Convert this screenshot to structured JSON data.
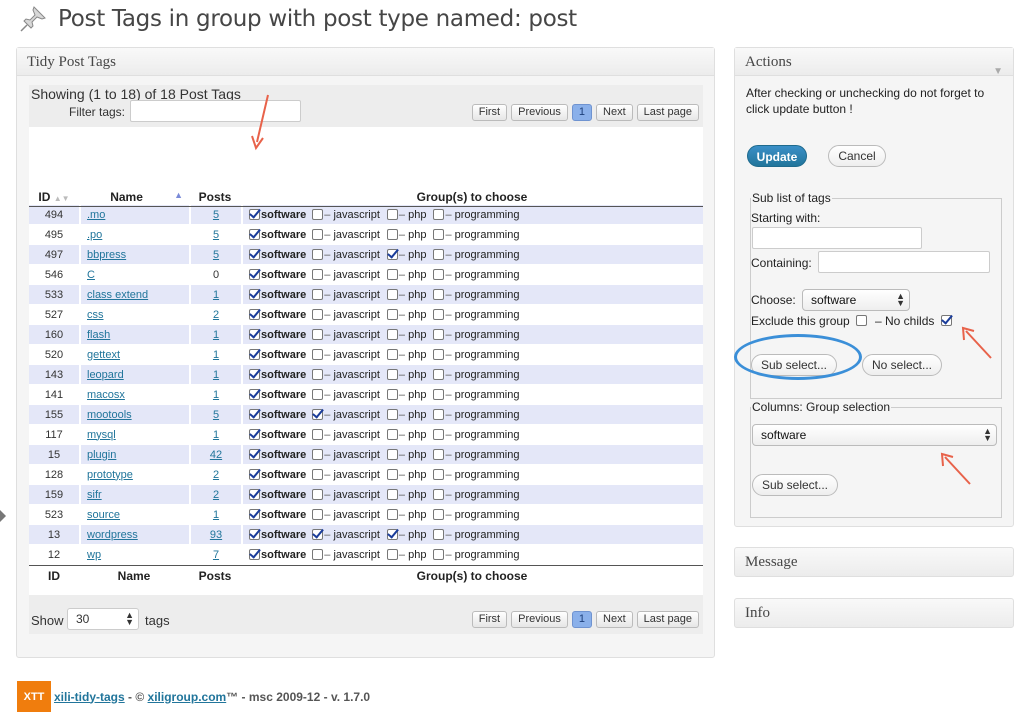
{
  "page": {
    "title": "Post Tags in group with post type named: post"
  },
  "tidy": {
    "title": "Tidy Post Tags",
    "showing": "Showing (1 to 18) of 18 Post Tags",
    "filter_label": "Filter tags:",
    "filter_value": "",
    "pager": {
      "first": "First",
      "previous": "Previous",
      "page": "1",
      "next": "Next",
      "last": "Last page"
    },
    "columns": {
      "id": "ID",
      "name": "Name",
      "posts": "Posts",
      "groups": "Group(s) to choose"
    },
    "group_names": [
      "software",
      "javascript",
      "php",
      "programming"
    ],
    "rows": [
      {
        "id": "494",
        "name": ".mo",
        "posts": "5",
        "posts_link": true,
        "checks": [
          true,
          false,
          false,
          false
        ]
      },
      {
        "id": "495",
        "name": ".po",
        "posts": "5",
        "posts_link": true,
        "checks": [
          true,
          false,
          false,
          false
        ]
      },
      {
        "id": "497",
        "name": "bbpress",
        "posts": "5",
        "posts_link": true,
        "checks": [
          true,
          false,
          true,
          false
        ]
      },
      {
        "id": "546",
        "name": "C",
        "posts": "0",
        "posts_link": false,
        "checks": [
          true,
          false,
          false,
          false
        ]
      },
      {
        "id": "533",
        "name": "class extend",
        "posts": "1",
        "posts_link": true,
        "checks": [
          true,
          false,
          false,
          false
        ]
      },
      {
        "id": "527",
        "name": "css",
        "posts": "2",
        "posts_link": true,
        "checks": [
          true,
          false,
          false,
          false
        ]
      },
      {
        "id": "160",
        "name": "flash",
        "posts": "1",
        "posts_link": true,
        "checks": [
          true,
          false,
          false,
          false
        ]
      },
      {
        "id": "520",
        "name": "gettext",
        "posts": "1",
        "posts_link": true,
        "checks": [
          true,
          false,
          false,
          false
        ]
      },
      {
        "id": "143",
        "name": "leopard",
        "posts": "1",
        "posts_link": true,
        "checks": [
          true,
          false,
          false,
          false
        ]
      },
      {
        "id": "141",
        "name": "macosx",
        "posts": "1",
        "posts_link": true,
        "checks": [
          true,
          false,
          false,
          false
        ]
      },
      {
        "id": "155",
        "name": "mootools",
        "posts": "5",
        "posts_link": true,
        "checks": [
          true,
          true,
          false,
          false
        ]
      },
      {
        "id": "117",
        "name": "mysql",
        "posts": "1",
        "posts_link": true,
        "checks": [
          true,
          false,
          false,
          false
        ]
      },
      {
        "id": "15",
        "name": "plugin",
        "posts": "42",
        "posts_link": true,
        "checks": [
          true,
          false,
          false,
          false
        ]
      },
      {
        "id": "128",
        "name": "prototype",
        "posts": "2",
        "posts_link": true,
        "checks": [
          true,
          false,
          false,
          false
        ]
      },
      {
        "id": "159",
        "name": "sifr",
        "posts": "2",
        "posts_link": true,
        "checks": [
          true,
          false,
          false,
          false
        ]
      },
      {
        "id": "523",
        "name": "source",
        "posts": "1",
        "posts_link": true,
        "checks": [
          true,
          false,
          false,
          false
        ]
      },
      {
        "id": "13",
        "name": "wordpress",
        "posts": "93",
        "posts_link": true,
        "checks": [
          true,
          true,
          true,
          false
        ]
      },
      {
        "id": "12",
        "name": "wp",
        "posts": "7",
        "posts_link": true,
        "checks": [
          true,
          false,
          false,
          false
        ]
      }
    ],
    "show_label": "Show",
    "show_value": "30",
    "tags_label": "tags"
  },
  "actions": {
    "title": "Actions",
    "note": "After checking or unchecking do not forget to click update button !",
    "update_label": "Update",
    "cancel_label": "Cancel",
    "sublist": {
      "legend": "Sub list of tags",
      "starting_label": "Starting with:",
      "containing_label": "Containing:",
      "choose_label": "Choose:",
      "choose_value": "software",
      "exclude_label": "Exclude this group",
      "nochilds_label": "– No childs",
      "exclude_checked": false,
      "nochilds_checked": true,
      "subselect_label": "Sub select...",
      "noselect_label": "No select..."
    },
    "columns": {
      "legend": "Columns: Group selection",
      "value": "software",
      "subselect_label": "Sub select..."
    }
  },
  "message": {
    "title": "Message"
  },
  "info": {
    "title": "Info"
  },
  "footer": {
    "logo": "XTT",
    "plugin": "xili-tidy-tags",
    "sep": " - © ",
    "company": "xiligroup.com",
    "rest": "™ - msc 2009-12 - v. 1.7.0"
  },
  "colors": {
    "accent": "#21759b",
    "annotation_arrow": "#e8624a",
    "highlight_oval": "#3b8fd8",
    "logo": "#f07d0d"
  }
}
